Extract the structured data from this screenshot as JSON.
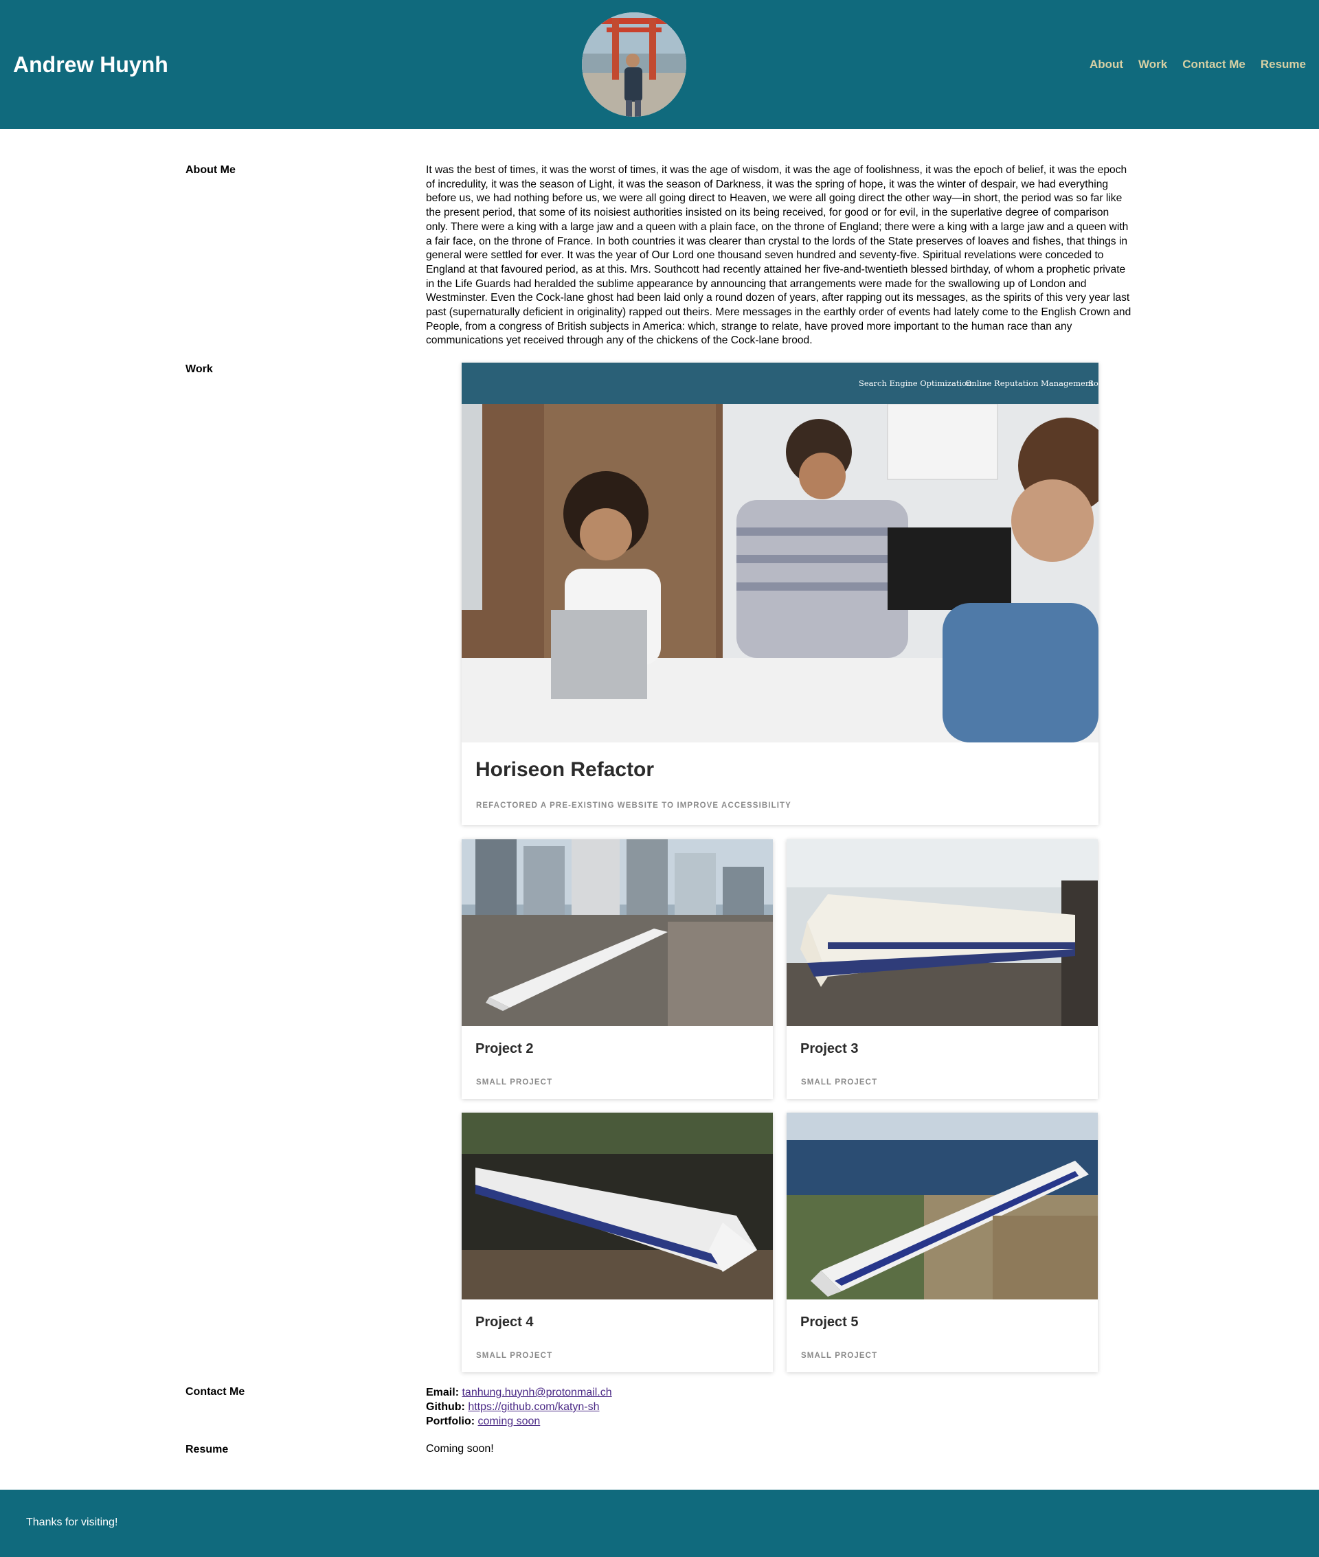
{
  "header": {
    "name": "Andrew Huynh",
    "avatar_alt": "profile photo at torii gate",
    "nav": [
      {
        "label": "About"
      },
      {
        "label": "Work"
      },
      {
        "label": "Contact Me"
      },
      {
        "label": "Resume"
      }
    ]
  },
  "about": {
    "heading": "About Me",
    "text": "It was the best of times, it was the worst of times, it was the age of wisdom, it was the age of foolishness, it was the epoch of belief, it was the epoch of incredulity, it was the season of Light, it was the season of Darkness, it was the spring of hope, it was the winter of despair, we had everything before us, we had nothing before us, we were all going direct to Heaven, we were all going direct the other way—in short, the period was so far like the present period, that some of its noisiest authorities insisted on its being received, for good or for evil, in the superlative degree of comparison only. There were a king with a large jaw and a queen with a plain face, on the throne of England; there were a king with a large jaw and a queen with a fair face, on the throne of France. In both countries it was clearer than crystal to the lords of the State preserves of loaves and fishes, that things in general were settled for ever. It was the year of Our Lord one thousand seven hundred and seventy-five. Spiritual revelations were conceded to England at that favoured period, as at this. Mrs. Southcott had recently attained her five-and-twentieth blessed birthday, of whom a prophetic private in the Life Guards had heralded the sublime appearance by announcing that arrangements were made for the swallowing up of London and Westminster. Even the Cock-lane ghost had been laid only a round dozen of years, after rapping out its messages, as the spirits of this very year last past (supernaturally deficient in originality) rapped out theirs. Mere messages in the earthly order of events had lately come to the English Crown and People, from a congress of British subjects in America: which, strange to relate, have proved more important to the human race than any communications yet received through any of the chickens of the Cock-lane brood."
  },
  "work": {
    "heading": "Work",
    "featured": {
      "title": "Horiseon Refactor",
      "subtitle": "Refactored a pre-existing website to improve accessibility",
      "screenshot_nav": [
        "Search Engine Optimization",
        "Online Reputation Management",
        "So"
      ]
    },
    "projects": [
      {
        "title": "Project 2",
        "subtitle": "Small Project"
      },
      {
        "title": "Project 3",
        "subtitle": "Small Project"
      },
      {
        "title": "Project 4",
        "subtitle": "Small Project"
      },
      {
        "title": "Project 5",
        "subtitle": "Small Project"
      }
    ]
  },
  "contact": {
    "heading": "Contact Me",
    "email_label": "Email:",
    "email": "tanhung.huynh@protonmail.ch",
    "github_label": "Github:",
    "github": "https://github.com/katyn-sh",
    "portfolio_label": "Portfolio:",
    "portfolio": "coming soon"
  },
  "resume": {
    "heading": "Resume",
    "text": "Coming soon!"
  },
  "footer": {
    "text": "Thanks for visiting!"
  }
}
